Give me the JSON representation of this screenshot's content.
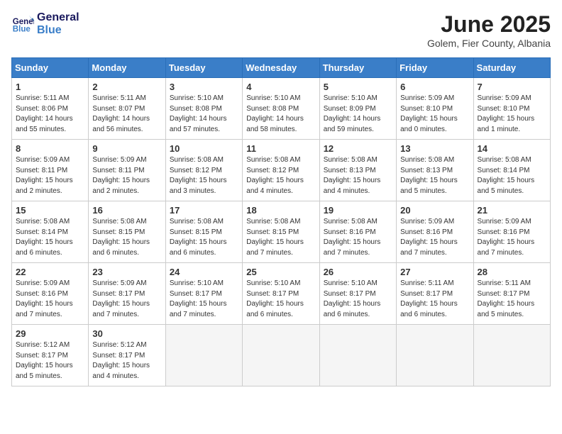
{
  "header": {
    "logo_line1": "General",
    "logo_line2": "Blue",
    "month_year": "June 2025",
    "location": "Golem, Fier County, Albania"
  },
  "weekdays": [
    "Sunday",
    "Monday",
    "Tuesday",
    "Wednesday",
    "Thursday",
    "Friday",
    "Saturday"
  ],
  "weeks": [
    [
      {
        "day": "1",
        "info": "Sunrise: 5:11 AM\nSunset: 8:06 PM\nDaylight: 14 hours\nand 55 minutes."
      },
      {
        "day": "2",
        "info": "Sunrise: 5:11 AM\nSunset: 8:07 PM\nDaylight: 14 hours\nand 56 minutes."
      },
      {
        "day": "3",
        "info": "Sunrise: 5:10 AM\nSunset: 8:08 PM\nDaylight: 14 hours\nand 57 minutes."
      },
      {
        "day": "4",
        "info": "Sunrise: 5:10 AM\nSunset: 8:08 PM\nDaylight: 14 hours\nand 58 minutes."
      },
      {
        "day": "5",
        "info": "Sunrise: 5:10 AM\nSunset: 8:09 PM\nDaylight: 14 hours\nand 59 minutes."
      },
      {
        "day": "6",
        "info": "Sunrise: 5:09 AM\nSunset: 8:10 PM\nDaylight: 15 hours\nand 0 minutes."
      },
      {
        "day": "7",
        "info": "Sunrise: 5:09 AM\nSunset: 8:10 PM\nDaylight: 15 hours\nand 1 minute."
      }
    ],
    [
      {
        "day": "8",
        "info": "Sunrise: 5:09 AM\nSunset: 8:11 PM\nDaylight: 15 hours\nand 2 minutes."
      },
      {
        "day": "9",
        "info": "Sunrise: 5:09 AM\nSunset: 8:11 PM\nDaylight: 15 hours\nand 2 minutes."
      },
      {
        "day": "10",
        "info": "Sunrise: 5:08 AM\nSunset: 8:12 PM\nDaylight: 15 hours\nand 3 minutes."
      },
      {
        "day": "11",
        "info": "Sunrise: 5:08 AM\nSunset: 8:12 PM\nDaylight: 15 hours\nand 4 minutes."
      },
      {
        "day": "12",
        "info": "Sunrise: 5:08 AM\nSunset: 8:13 PM\nDaylight: 15 hours\nand 4 minutes."
      },
      {
        "day": "13",
        "info": "Sunrise: 5:08 AM\nSunset: 8:13 PM\nDaylight: 15 hours\nand 5 minutes."
      },
      {
        "day": "14",
        "info": "Sunrise: 5:08 AM\nSunset: 8:14 PM\nDaylight: 15 hours\nand 5 minutes."
      }
    ],
    [
      {
        "day": "15",
        "info": "Sunrise: 5:08 AM\nSunset: 8:14 PM\nDaylight: 15 hours\nand 6 minutes."
      },
      {
        "day": "16",
        "info": "Sunrise: 5:08 AM\nSunset: 8:15 PM\nDaylight: 15 hours\nand 6 minutes."
      },
      {
        "day": "17",
        "info": "Sunrise: 5:08 AM\nSunset: 8:15 PM\nDaylight: 15 hours\nand 6 minutes."
      },
      {
        "day": "18",
        "info": "Sunrise: 5:08 AM\nSunset: 8:15 PM\nDaylight: 15 hours\nand 7 minutes."
      },
      {
        "day": "19",
        "info": "Sunrise: 5:08 AM\nSunset: 8:16 PM\nDaylight: 15 hours\nand 7 minutes."
      },
      {
        "day": "20",
        "info": "Sunrise: 5:09 AM\nSunset: 8:16 PM\nDaylight: 15 hours\nand 7 minutes."
      },
      {
        "day": "21",
        "info": "Sunrise: 5:09 AM\nSunset: 8:16 PM\nDaylight: 15 hours\nand 7 minutes."
      }
    ],
    [
      {
        "day": "22",
        "info": "Sunrise: 5:09 AM\nSunset: 8:16 PM\nDaylight: 15 hours\nand 7 minutes."
      },
      {
        "day": "23",
        "info": "Sunrise: 5:09 AM\nSunset: 8:17 PM\nDaylight: 15 hours\nand 7 minutes."
      },
      {
        "day": "24",
        "info": "Sunrise: 5:10 AM\nSunset: 8:17 PM\nDaylight: 15 hours\nand 7 minutes."
      },
      {
        "day": "25",
        "info": "Sunrise: 5:10 AM\nSunset: 8:17 PM\nDaylight: 15 hours\nand 6 minutes."
      },
      {
        "day": "26",
        "info": "Sunrise: 5:10 AM\nSunset: 8:17 PM\nDaylight: 15 hours\nand 6 minutes."
      },
      {
        "day": "27",
        "info": "Sunrise: 5:11 AM\nSunset: 8:17 PM\nDaylight: 15 hours\nand 6 minutes."
      },
      {
        "day": "28",
        "info": "Sunrise: 5:11 AM\nSunset: 8:17 PM\nDaylight: 15 hours\nand 5 minutes."
      }
    ],
    [
      {
        "day": "29",
        "info": "Sunrise: 5:12 AM\nSunset: 8:17 PM\nDaylight: 15 hours\nand 5 minutes."
      },
      {
        "day": "30",
        "info": "Sunrise: 5:12 AM\nSunset: 8:17 PM\nDaylight: 15 hours\nand 4 minutes."
      },
      {
        "day": "",
        "info": ""
      },
      {
        "day": "",
        "info": ""
      },
      {
        "day": "",
        "info": ""
      },
      {
        "day": "",
        "info": ""
      },
      {
        "day": "",
        "info": ""
      }
    ]
  ]
}
